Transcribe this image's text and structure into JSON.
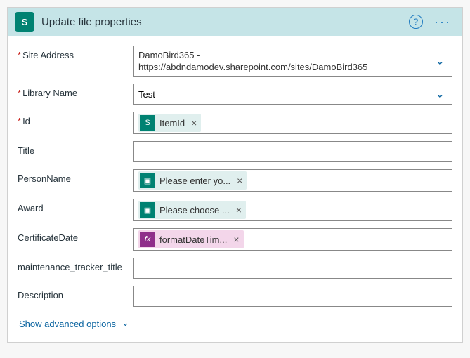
{
  "header": {
    "title": "Update file properties"
  },
  "siteAddress": {
    "label": "Site Address",
    "line1": "DamoBird365 -",
    "line2": "https://abdndamodev.sharepoint.com/sites/DamoBird365"
  },
  "libraryName": {
    "label": "Library Name",
    "value": "Test"
  },
  "id": {
    "label": "Id",
    "tokenLabel": "ItemId"
  },
  "title": {
    "label": "Title"
  },
  "personName": {
    "label": "PersonName",
    "tokenLabel": "Please enter yo..."
  },
  "award": {
    "label": "Award",
    "tokenLabel": "Please choose ..."
  },
  "certDate": {
    "label": "CertificateDate",
    "tokenLabel": "formatDateTim..."
  },
  "maint": {
    "label": "maintenance_tracker_title"
  },
  "desc": {
    "label": "Description"
  },
  "advanced": "Show advanced options"
}
